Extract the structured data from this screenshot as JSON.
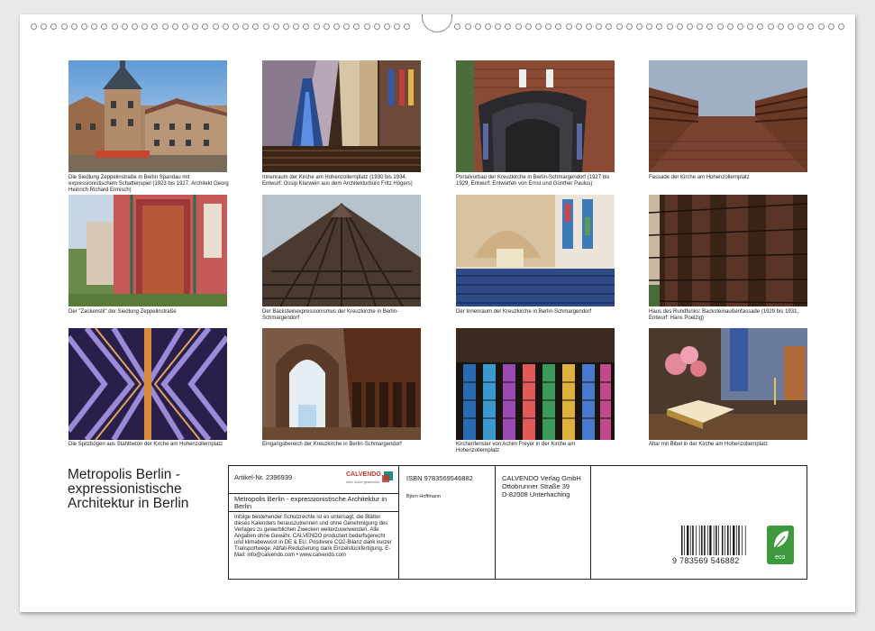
{
  "captions": [
    "Die Siedlung Zeppelinstraße in Berlin Spandau mit expressionistischem Schattenspiel (1923 bis 1927, Architekt Georg Heinrich Richard Ermisch)",
    "Innenraum der Kirche am Hohenzollernplatz (1930 bis 1934, Entwurf: Ossip Klarwein aus dem Architekturbüro Fritz Högers)",
    "Portalvorbau der Kreuzkirche in Berlin-Schmargendorf (1927 bis 1929, Entwurf: Entwürfen von Ernst und Günther Paulus)",
    "Fassade der Kirche am Hohenzollernplatz",
    "Der \"Zackenstil\" der Siedlung Zeppelinstraße",
    "Der Backsteinexpressionismus der Kreuzkirche in Berlin-Schmargendorf",
    "Der Innenraum der Kreuzkirche in Berlin-Schmargendorf",
    "Haus des Rundfunks: Backsteinaußenfassade (1929 bis 1931, Entwurf: Hans Poelzig)",
    "Die Spitzbögen aus Stahlbeton der Kirche am Hohenzollernplatz",
    "Eingangsbereich der Kreuzkirche in Berlin-Schmargendorf",
    "Kirchenfenster von Achim Freyer in der Kirche am Hohenzollernplatz",
    "Altar mit Bibel in der Kirche am Hohenzollernplatz"
  ],
  "title": "Metropolis Berlin - expressionistische Architektur in Berlin",
  "info": {
    "article_no": "Artikel-Nr. 2396939",
    "brand": "CALVENDO",
    "brand_tagline": "Alles. Außer gewöhnlich.",
    "isbn": "ISBN 9783569546882",
    "publisher": "CALVENDO Verlag GmbH\nOttobrunner Straße 39\nD-82008 Unterhaching",
    "product_title": "Metropolis Berlin - expressionistische Architektur in Berlin",
    "author": "Björn Hoffmann",
    "legal": "Infolge bestehender Schutzrechte ist es untersagt, die Blätter dieses Kalenders herauszutrennen und ohne Genehmigung des Verlages zu gewerblichen Zwecken weiterzuverwenden. Alle Angaben ohne Gewähr. CALVENDO produziert bedarfsgerecht und klimabewusst in DE & EU. Positivere CO2-Bilanz dank kurzer Transportwege. Abfall-Reduzierung dank Einzelstückfertigung. E-Mail: info@calvendo.com • www.calvendo.com",
    "barcode_digits": "9 783569 546882",
    "eco_label": "eco"
  },
  "colors": {
    "brand_red": "#c0392b",
    "eco_green": "#3c9a3c",
    "brand_teal": "#1e8a8a"
  }
}
